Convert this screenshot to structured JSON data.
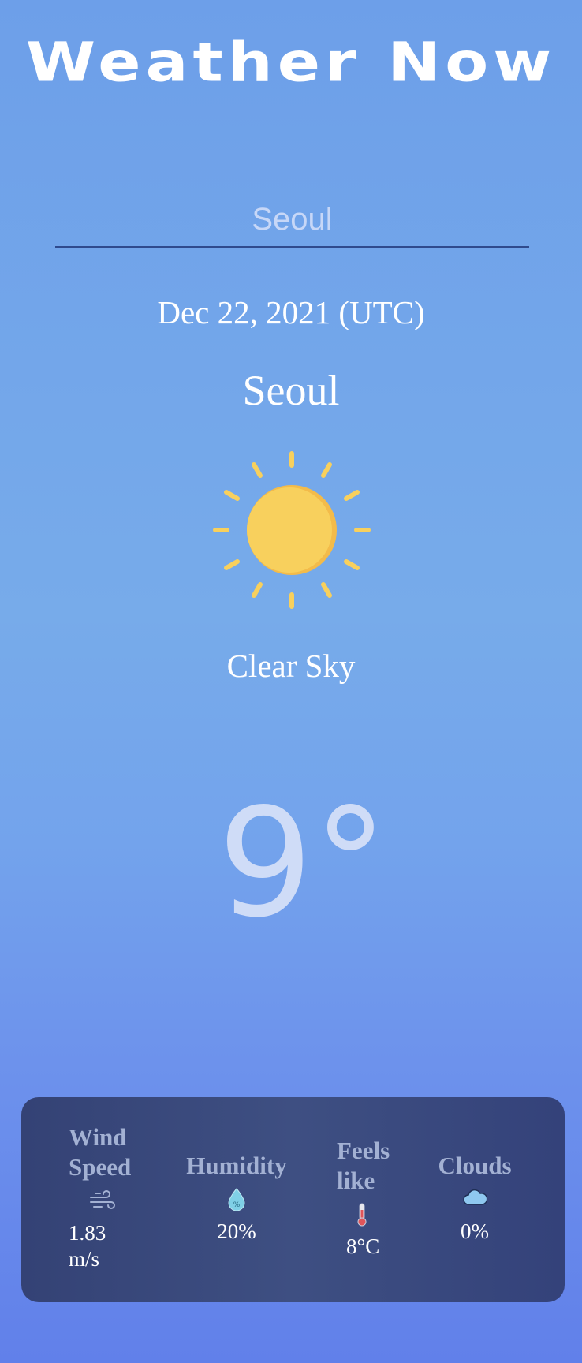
{
  "header": {
    "title": "Weather Now"
  },
  "search": {
    "value": "Seoul",
    "placeholder": ""
  },
  "date": "Dec 22, 2021 (UTC)",
  "city": "Seoul",
  "weather": {
    "icon": "sun-icon",
    "condition": "Clear Sky",
    "temperature": "9°"
  },
  "details": [
    {
      "label": "Wind Speed",
      "icon": "wind-icon",
      "value": "1.83 m/s"
    },
    {
      "label": "Humidity",
      "icon": "water-drop-icon",
      "value": "20%"
    },
    {
      "label": "Feels like",
      "icon": "thermometer-icon",
      "value": "8°C"
    },
    {
      "label": "Clouds",
      "icon": "cloud-icon",
      "value": "0%"
    }
  ],
  "colors": {
    "sun": "#f8d05d",
    "sun_shade": "#f3bb4a",
    "panel": "#3a4a7c",
    "underline": "#2f4a8d"
  }
}
